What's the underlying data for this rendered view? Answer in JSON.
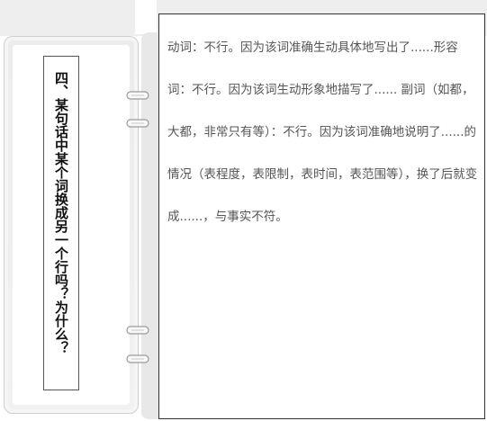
{
  "question_title": "四、某句话中某个词换成另一个行吗？为什么？",
  "answer": {
    "paragraph": "动词：不行。因为该词准确生动具体地写出了......形容词：不行。因为该词生动形象地描写了...... 副词（如都，大都，非常只有等）：不行。因为该词准确地说明了......的情况（表程度，表限制，表时间，表范围等），换了后就变成......，与事实不符。"
  },
  "icons": {
    "binder_rings": [
      "binder-ring-icon",
      "binder-ring-icon",
      "binder-ring-icon",
      "binder-ring-icon"
    ]
  }
}
